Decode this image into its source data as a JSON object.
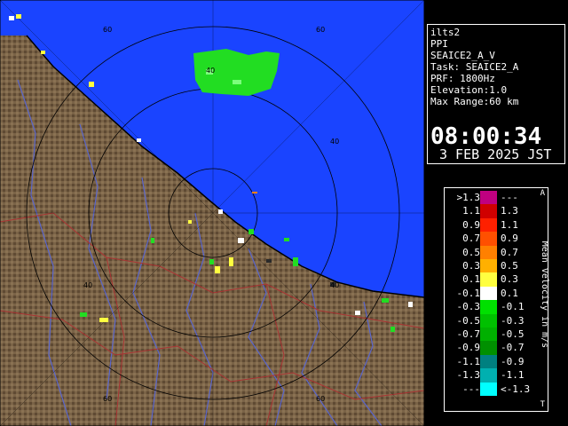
{
  "radar_info": {
    "site": "ilts2",
    "product": "PPI",
    "scan": "SEAICE2_A_V",
    "task": "Task: SEAICE2_A",
    "prf": "PRF: 1800Hz",
    "elevation": "Elevation:1.0",
    "max_range": "Max Range:60 km",
    "time": "08:00:34",
    "date": "3 FEB 2025 JST"
  },
  "range_rings": {
    "labels": [
      "60",
      "60",
      "40",
      "40",
      "40",
      "40",
      "60",
      "60"
    ]
  },
  "legend": {
    "title": "Mean Velocity in m/s",
    "top_mark": "A",
    "bottom_mark": "T",
    "rows": [
      {
        "lo": ">1.3",
        "hi": "---",
        "color": "#c00080"
      },
      {
        "lo": "1.1",
        "hi": "1.3",
        "color": "#d00000"
      },
      {
        "lo": "0.9",
        "hi": "1.1",
        "color": "#ff2000"
      },
      {
        "lo": "0.7",
        "hi": "0.9",
        "color": "#ff5000"
      },
      {
        "lo": "0.5",
        "hi": "0.7",
        "color": "#ff8000"
      },
      {
        "lo": "0.3",
        "hi": "0.5",
        "color": "#ffb000"
      },
      {
        "lo": "0.1",
        "hi": "0.3",
        "color": "#ffff40"
      },
      {
        "lo": "-0.1",
        "hi": "0.1",
        "color": "#ffffff"
      },
      {
        "lo": "-0.3",
        "hi": "-0.1",
        "color": "#00e000"
      },
      {
        "lo": "-0.5",
        "hi": "-0.3",
        "color": "#00c000"
      },
      {
        "lo": "-0.7",
        "hi": "-0.5",
        "color": "#00b000"
      },
      {
        "lo": "-0.9",
        "hi": "-0.7",
        "color": "#009000"
      },
      {
        "lo": "-1.1",
        "hi": "-0.9",
        "color": "#008080"
      },
      {
        "lo": "-1.3",
        "hi": "-1.1",
        "color": "#00b0b0"
      },
      {
        "lo": "---",
        "hi": "<-1.3",
        "color": "#00ffff"
      }
    ]
  },
  "colors": {
    "sea": "#1a44ff",
    "land": "#7a6347",
    "ring": "#000000",
    "river": "#5a66cc",
    "border": "#aa3333"
  }
}
